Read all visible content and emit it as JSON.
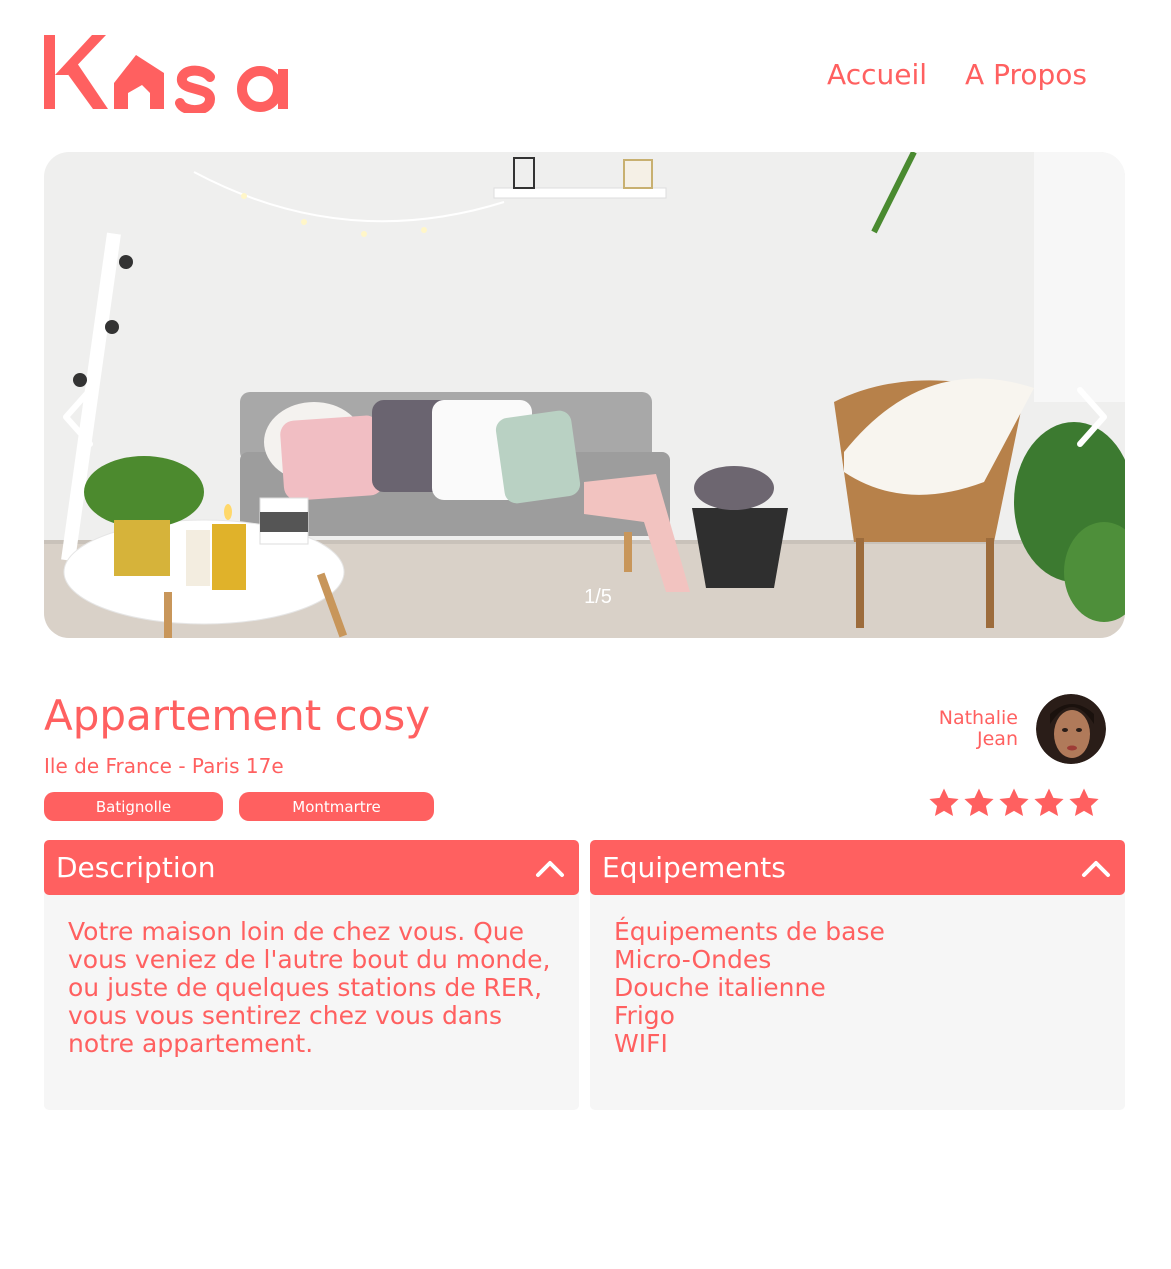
{
  "header": {
    "logo_text": "Kasa",
    "nav": [
      {
        "label": "Accueil"
      },
      {
        "label": "A Propos"
      }
    ]
  },
  "slideshow": {
    "counter": "1/5",
    "left_icon": "chevron-left-icon",
    "right_icon": "chevron-right-icon"
  },
  "listing": {
    "title": "Appartement cosy",
    "location": "Ile de France - Paris 17e",
    "tags": [
      "Batignolle",
      "Montmartre"
    ],
    "host": {
      "first_name": "Nathalie",
      "last_name": "Jean"
    },
    "rating": 5,
    "rating_max": 5
  },
  "collapses": {
    "description": {
      "title": "Description",
      "text": "Votre maison loin de chez vous. Que vous veniez de l'autre bout du monde, ou juste de quelques stations de RER, vous vous sentirez chez vous dans notre appartement."
    },
    "equipments": {
      "title": "Equipements",
      "items": [
        "Équipements de base",
        "Micro-Ondes",
        "Douche italienne",
        "Frigo",
        "WIFI"
      ]
    }
  },
  "colors": {
    "primary": "#FF6060",
    "panel_bg": "#F6F6F6",
    "star_inactive": "#E3E3E3"
  }
}
